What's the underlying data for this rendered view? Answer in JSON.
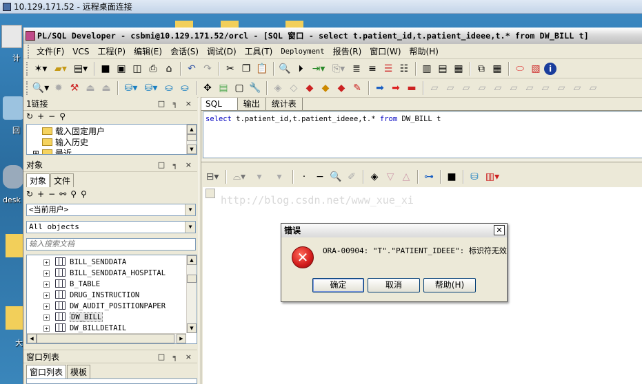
{
  "rdp": {
    "title": "10.129.171.52 - 远程桌面连接"
  },
  "desktop": {
    "labels": [
      "计",
      "回",
      "desk",
      "大"
    ]
  },
  "app": {
    "title": "PL/SQL Developer - csbmi@10.129.171.52/orcl - [SQL 窗口 - select t.patient_id,t.patient_ideee,t.* from DW_BILL t]",
    "menu": [
      "文件(F)",
      "VCS",
      "工程(P)",
      "编辑(E)",
      "会话(S)",
      "调试(D)",
      "工具(T)",
      "Deployment",
      "报告(R)",
      "窗口(W)",
      "帮助(H)"
    ]
  },
  "links_panel": {
    "title": "1链接",
    "controls": "□ ╕ ×",
    "items": [
      "载入固定用户",
      "输入历史",
      "最近"
    ]
  },
  "objects_panel": {
    "title": "对象",
    "controls": "□ ╕ ×",
    "tabs": [
      "对象",
      "文件"
    ],
    "user_combo": "<当前用户>",
    "type_combo": "All objects",
    "search_placeholder": "输入搜索文档",
    "items": [
      "BILL_SENDDATA",
      "BILL_SENDDATA_HOSPITAL",
      "B_TABLE",
      "DRUG_INSTRUCTION",
      "DW_AUDIT_POSITIONPAPER",
      "DW_BILL",
      "DW_BILLDETAIL"
    ]
  },
  "window_list_panel": {
    "title": "窗口列表",
    "controls": "□ ╕ ×",
    "tabs": [
      "窗口列表",
      "模板"
    ]
  },
  "editor": {
    "tabs": [
      "SQL",
      "输出",
      "统计表"
    ],
    "sql_kw1": "select",
    "sql_mid": " t.patient_id,t.patient_ideee,t.* ",
    "sql_kw2": "from",
    "sql_tail": " DW_BILL t"
  },
  "watermark": "http://blog.csdn.net/www_xue_xi",
  "error_dialog": {
    "title": "错误",
    "message": "ORA-00904: \"T\".\"PATIENT_IDEEE\": 标识符无效",
    "buttons": {
      "ok": "确定",
      "cancel": "取消",
      "help": "帮助(H)"
    }
  },
  "colors": {
    "error_icon": "#d21c1c",
    "sql_keyword": "#0000c0",
    "desktop": "#2d6d9b"
  }
}
